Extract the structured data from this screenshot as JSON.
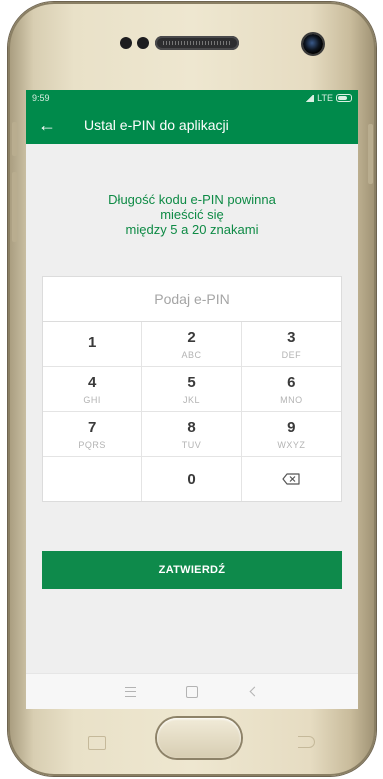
{
  "status": {
    "time": "9:59",
    "network": "LTE"
  },
  "appbar": {
    "title": "Ustal e-PIN do aplikacji",
    "back_icon": "arrow-left-icon"
  },
  "info": {
    "line1": "Długość kodu e-PIN powinna",
    "line2": "mieścić się",
    "line3": "między 5 a 20 znakami"
  },
  "pin": {
    "placeholder": "Podaj e-PIN",
    "value": ""
  },
  "keys": [
    {
      "num": "1",
      "letters": ""
    },
    {
      "num": "2",
      "letters": "ABC"
    },
    {
      "num": "3",
      "letters": "DEF"
    },
    {
      "num": "4",
      "letters": "GHI"
    },
    {
      "num": "5",
      "letters": "JKL"
    },
    {
      "num": "6",
      "letters": "MNO"
    },
    {
      "num": "7",
      "letters": "PQRS"
    },
    {
      "num": "8",
      "letters": "TUV"
    },
    {
      "num": "9",
      "letters": "WXYZ"
    },
    {
      "num": "0",
      "letters": ""
    }
  ],
  "confirm_label": "ZATWIERDŹ",
  "colors": {
    "brand_green": "#008a4b",
    "info_text": "#0e8a45"
  }
}
